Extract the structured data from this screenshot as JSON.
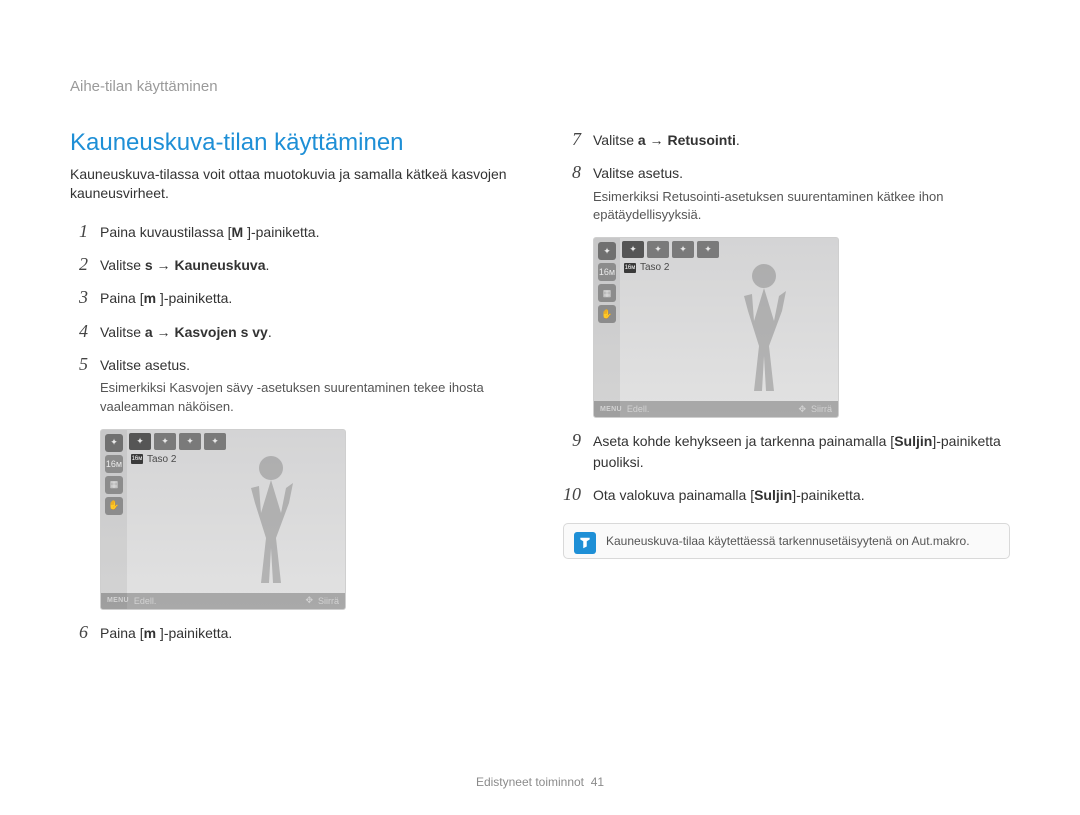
{
  "breadcrumb": "Aihe-tilan käyttäminen",
  "section_title": "Kauneuskuva-tilan käyttäminen",
  "intro": "Kauneuskuva-tilassa voit ottaa muotokuvia ja samalla kätkeä kasvojen kauneusvirheet.",
  "left_steps": [
    {
      "n": "1",
      "parts": [
        "Paina kuvaustilassa [",
        "M",
        "       ]-painiketta."
      ]
    },
    {
      "n": "2",
      "parts": [
        "Valitse ",
        "s",
        "     → ",
        "Kauneuskuva",
        "."
      ]
    },
    {
      "n": "3",
      "parts": [
        "Paina [",
        "m",
        "       ]-painiketta."
      ]
    },
    {
      "n": "4",
      "parts": [
        "Valitse ",
        "a",
        "     → ",
        "Kasvojen s vy",
        "."
      ]
    },
    {
      "n": "5",
      "parts": [
        "Valitse asetus."
      ],
      "sub": "Esimerkiksi Kasvojen sävy -asetuksen suurentaminen tekee ihosta vaaleamman näköisen."
    }
  ],
  "step6": {
    "n": "6",
    "parts": [
      "Paina [",
      "m",
      "       ]-painiketta."
    ]
  },
  "right_steps_a": [
    {
      "n": "7",
      "parts": [
        "Valitse ",
        "a",
        "     → ",
        "Retusointi",
        "."
      ]
    },
    {
      "n": "8",
      "parts": [
        "Valitse asetus."
      ],
      "sub": "Esimerkiksi Retusointi-asetuksen suurentaminen kätkee ihon epätäydellisyyksiä."
    }
  ],
  "right_steps_b": [
    {
      "n": "9",
      "parts": [
        "Aseta kohde kehykseen ja tarkenna painamalla [",
        "Suljin",
        "]-painiketta puoliksi."
      ]
    },
    {
      "n": "10",
      "parts": [
        "Ota valokuva painamalla [",
        "Suljin",
        "]-painiketta."
      ]
    }
  ],
  "preview": {
    "level_label": "Taso 2",
    "bottom_left": "Edell.",
    "bottom_right": "Siirrä",
    "menu_label": "MENU"
  },
  "note_text": "Kauneuskuva-tilaa käytettäessä tarkennusetäisyytenä on Aut.makro.",
  "footer_section": "Edistyneet toiminnot",
  "footer_page": "41"
}
